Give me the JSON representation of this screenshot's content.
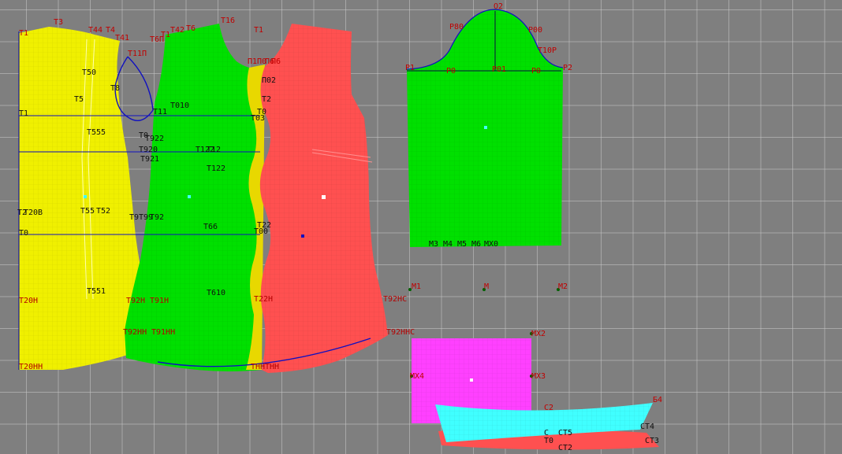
{
  "colors": {
    "background": "#7f7f7f",
    "grid": "#c8c8c8",
    "yellow_piece": "#f0f000",
    "green_piece": "#00e000",
    "red_piece": "#ff5050",
    "magenta_piece": "#ff40ff",
    "cyan_piece": "#40ffff",
    "label": "#c00000",
    "construction_line": "#1010c0",
    "point": "#006000"
  },
  "labels": {
    "yellow": [
      "Т1",
      "Т3",
      "Т44",
      "Т4",
      "Т41",
      "Т50",
      "Т8",
      "Т5",
      "Т1",
      "Т555",
      "Т2",
      "Т22",
      "Т20В",
      "Т55",
      "Т52",
      "Т2",
      "Т0",
      "Т551",
      "Т20Н",
      "Т20НН"
    ],
    "green_back": [
      "Т16",
      "Т11П",
      "Т6П",
      "Т42",
      "Т6",
      "Т1",
      "Т11",
      "Т010",
      "Т11",
      "Т0",
      "Т922",
      "Т920",
      "Т921",
      "Т122",
      "Т12",
      "Т122",
      "Т9",
      "Т92",
      "Т99",
      "Т66",
      "Т92Н",
      "Т91Н",
      "Т610",
      "Т92НН",
      "Т91НН",
      "Т1",
      "Т1"
    ],
    "red_front": [
      "П1",
      "П0",
      "П6",
      "П6",
      "П02",
      "Т2",
      "Т0",
      "Т03",
      "Т1",
      "Т22",
      "Т00",
      "Т22Н",
      "Т92НС",
      "Т92ННС",
      "ТНН",
      "ТНН"
    ],
    "sleeve": [
      "О2",
      "Р80",
      "Р00",
      "Т10Р",
      "Р1",
      "Р0",
      "Р01",
      "Р0",
      "Р2",
      "М3",
      "М4",
      "М5",
      "М6",
      "МХ0"
    ],
    "markers": [
      "М1",
      "М",
      "М2",
      "МХ2",
      "МХ4",
      "МХ3"
    ],
    "belt": [
      "Б4",
      "С2",
      "СТ5",
      "СТ4",
      "СТ3",
      "Т0",
      "СТ2",
      "С"
    ]
  }
}
